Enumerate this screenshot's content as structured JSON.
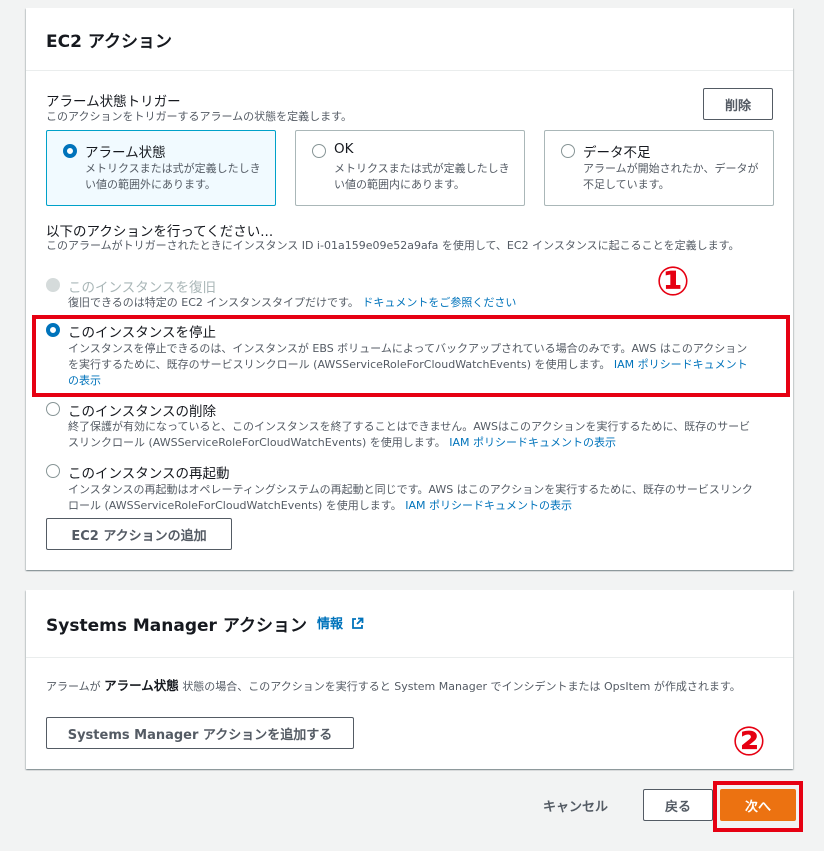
{
  "ec2": {
    "title": "EC2 アクション",
    "trigger_label": "アラーム状態トリガー",
    "trigger_desc": "このアクションをトリガーするアラームの状態を定義します。",
    "remove_button": "削除",
    "states": [
      {
        "label": "アラーム状態",
        "desc": "メトリクスまたは式が定義したしきい値の範囲外にあります。",
        "selected": true
      },
      {
        "label": "OK",
        "desc": "メトリクスまたは式が定義したしきい値の範囲内にあります。",
        "selected": false
      },
      {
        "label": "データ不足",
        "desc": "アラームが開始されたか、データが不足しています。",
        "selected": false
      }
    ],
    "action_label": "以下のアクションを行ってください...",
    "action_desc": "このアラームがトリガーされたときにインスタンス ID i-01a159e09e52a9afa を使用して、EC2 インスタンスに起こることを定義します。",
    "options": [
      {
        "title": "このインスタンスを復旧",
        "desc": "復旧できるのは特定の EC2 インスタンスタイプだけです。",
        "link": "ドキュメントをご参照ください",
        "state": "disabled"
      },
      {
        "title": "このインスタンスを停止",
        "desc": "インスタンスを停止できるのは、インスタンスが EBS ボリュームによってバックアップされている場合のみです。AWS はこのアクションを実行するために、既存のサービスリンクロール (AWSServiceRoleForCloudWatchEvents) を使用します。",
        "link": "IAM ポリシードキュメントの表示",
        "state": "selected"
      },
      {
        "title": "このインスタンスの削除",
        "desc": "終了保護が有効になっていると、このインスタンスを終了することはできません。AWSはこのアクションを実行するために、既存のサービスリンクロール (AWSServiceRoleForCloudWatchEvents) を使用します。",
        "link": "IAM ポリシードキュメントの表示",
        "state": "unselected"
      },
      {
        "title": "このインスタンスの再起動",
        "desc": "インスタンスの再起動はオペレーティングシステムの再起動と同じです。AWS はこのアクションを実行するために、既存のサービスリンクロール (AWSServiceRoleForCloudWatchEvents) を使用します。",
        "link": "IAM ポリシードキュメントの表示",
        "state": "unselected"
      }
    ],
    "add_button": "EC2 アクションの追加"
  },
  "ssm": {
    "title": "Systems Manager アクション",
    "info_link": "情報",
    "desc_prefix": "アラームが",
    "desc_bold": "アラーム状態",
    "desc_suffix": "状態の場合、このアクションを実行すると System Manager でインシデントまたは OpsItem が作成されます。",
    "add_button": "Systems Manager アクションを追加する"
  },
  "footer": {
    "cancel": "キャンセル",
    "back": "戻る",
    "next": "次へ"
  },
  "annotations": {
    "marker1": "①",
    "marker2": "②",
    "color": "#e60012"
  },
  "colors": {
    "primary": "#ec7211",
    "link": "#0073bb",
    "selected_border": "#00a1c9"
  }
}
